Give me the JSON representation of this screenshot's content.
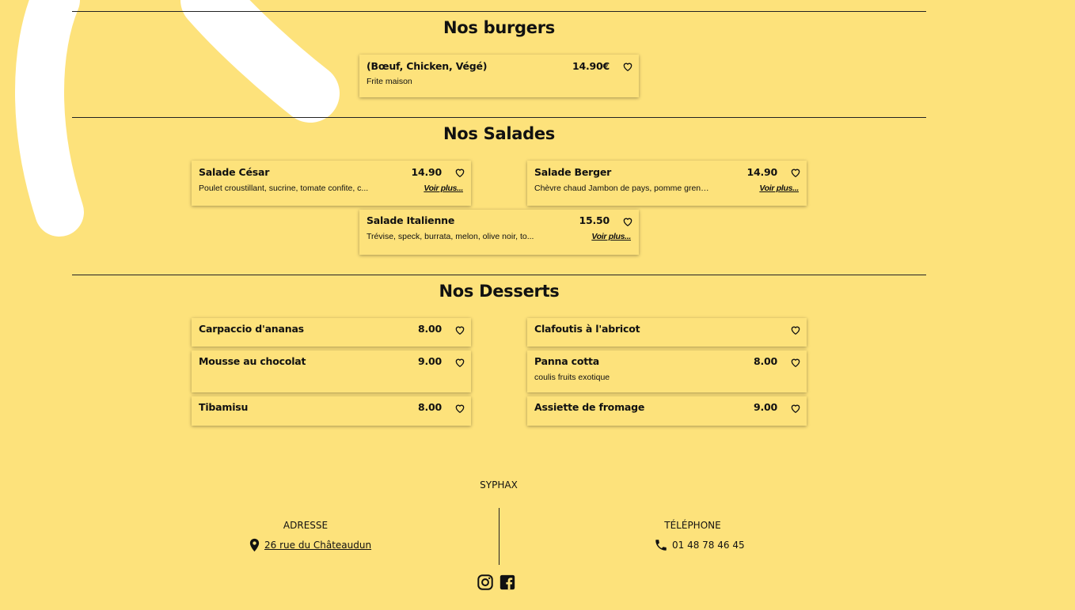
{
  "sections": {
    "burgers": {
      "title": "Nos burgers",
      "items": [
        {
          "name": "(Bœuf, Chicken, Végé)",
          "price": "14.90€",
          "description": "Frite maison"
        }
      ]
    },
    "salades": {
      "title": "Nos Salades",
      "more_label": "Voir plus...",
      "items": [
        {
          "name": "Salade César",
          "price": "14.90",
          "description": "Poulet croustillant, sucrine, tomate confite, c..."
        },
        {
          "name": "Salade Berger",
          "price": "14.90",
          "description": "Chèvre chaud Jambon de pays, pomme grena..."
        },
        {
          "name": "Salade Italienne",
          "price": "15.50",
          "description": "Trévise, speck, burrata, melon, olive noir, to..."
        }
      ]
    },
    "desserts": {
      "title": "Nos Desserts",
      "items": [
        {
          "name": "Carpaccio d'ananas",
          "price": "8.00",
          "description": ""
        },
        {
          "name": "Clafoutis à l'abricot",
          "price": "",
          "description": ""
        },
        {
          "name": "Mousse au chocolat",
          "price": "9.00",
          "description": ""
        },
        {
          "name": "Panna cotta",
          "price": "8.00",
          "description": "coulis fruits exotique"
        },
        {
          "name": "Tibamisu",
          "price": "8.00",
          "description": ""
        },
        {
          "name": "Assiette de fromage",
          "price": "9.00",
          "description": ""
        }
      ]
    }
  },
  "footer": {
    "brand": "SYPHAX",
    "address_label": "ADRESSE",
    "address_value": "26 rue du Châteaudun",
    "phone_label": "TÉLÉPHONE",
    "phone_value": "01 48 78 46 45",
    "social": [
      "instagram-icon",
      "facebook-icon"
    ]
  },
  "colors": {
    "background": "#fde27b",
    "text": "#111111",
    "brush": "#ffffff"
  }
}
